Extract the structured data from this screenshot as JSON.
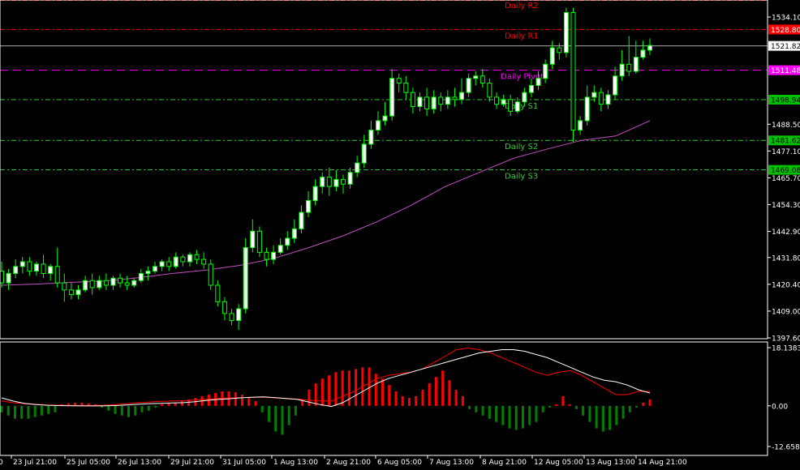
{
  "chart_data": [
    {
      "type": "candlestick",
      "price_axis_ticks": [
        "1534.10",
        "1521.82",
        "1511.48",
        "1498.94",
        "1488.50",
        "1477.10",
        "1465.70",
        "1454.30",
        "1442.90",
        "1431.80",
        "1420.40",
        "1409.00",
        "1397.60"
      ],
      "time_axis_ticks": [
        "23 Jul 21:00",
        "25 Jul 05:00",
        "26 Jul 13:00",
        "29 Jul 21:00",
        "31 Jul 05:00",
        "1 Aug 13:00",
        "2 Aug 21:00",
        "6 Aug 05:00",
        "7 Aug 13:00",
        "8 Aug 21:00",
        "12 Aug 05:00",
        "13 Aug 13:00",
        "14 Aug 21:00"
      ],
      "ylim": [
        1397.6,
        1534.1
      ],
      "current_price": "1521.82",
      "pivot_levels": [
        {
          "label": "Daily R2",
          "price_label": "",
          "price": 1542.0,
          "color": "#ff0000",
          "style": "dashdot"
        },
        {
          "label": "Daily R1",
          "price_label": "1528.80",
          "price": 1528.8,
          "color": "#ff0000",
          "style": "dashdot"
        },
        {
          "label": "Daily Pivot",
          "price_label": "1511.48",
          "price": 1511.48,
          "color": "#ff00ff",
          "style": "dashed"
        },
        {
          "label": "Daily S1",
          "price_label": "1498.94",
          "price": 1498.94,
          "color": "#32cd32",
          "style": "dashdot"
        },
        {
          "label": "Daily S2",
          "price_label": "1481.62",
          "price": 1481.62,
          "color": "#32cd32",
          "style": "dashdot"
        },
        {
          "label": "Daily S3",
          "price_label": "1469.08",
          "price": 1469.08,
          "color": "#32cd32",
          "style": "dashdot"
        }
      ],
      "colors": {
        "up_candle": "#ffffff",
        "down_candle": "#000000",
        "wick": "#00ff00",
        "moving_average": "#c050c0",
        "grid_line": "#ffffff"
      },
      "moving_average": [
        1420.0,
        1420.5,
        1421.2,
        1421.8,
        1423.2,
        1425.0,
        1426.5,
        1428.5,
        1431.5,
        1436.0,
        1441.0,
        1447.0,
        1454.0,
        1462.0,
        1468.0,
        1474.0,
        1478.0,
        1481.62,
        1483.5,
        1490.0
      ],
      "candles": [
        [
          1426,
          1421,
          1430,
          1419
        ],
        [
          1421,
          1425,
          1427,
          1418
        ],
        [
          1425,
          1428,
          1431,
          1423
        ],
        [
          1428,
          1430,
          1432,
          1425
        ],
        [
          1430,
          1426,
          1432,
          1424
        ],
        [
          1426,
          1429,
          1430,
          1424
        ],
        [
          1429,
          1425,
          1433,
          1423
        ],
        [
          1425,
          1428,
          1429,
          1422
        ],
        [
          1428,
          1421,
          1436,
          1419
        ],
        [
          1421,
          1418,
          1425,
          1413
        ],
        [
          1418,
          1416,
          1421,
          1414
        ],
        [
          1416,
          1418,
          1420,
          1414
        ],
        [
          1418,
          1422,
          1424,
          1417
        ],
        [
          1422,
          1419,
          1425,
          1416
        ],
        [
          1419,
          1422,
          1424,
          1418
        ],
        [
          1422,
          1420,
          1425,
          1418
        ],
        [
          1420,
          1423,
          1424,
          1418
        ],
        [
          1423,
          1421,
          1425,
          1419
        ],
        [
          1421,
          1420,
          1424,
          1418
        ],
        [
          1420,
          1422,
          1423,
          1419
        ],
        [
          1422,
          1425,
          1427,
          1421
        ],
        [
          1425,
          1426,
          1428,
          1422
        ],
        [
          1426,
          1428,
          1430,
          1425
        ],
        [
          1428,
          1430,
          1431,
          1426
        ],
        [
          1430,
          1428,
          1432,
          1426
        ],
        [
          1428,
          1432,
          1434,
          1427
        ],
        [
          1432,
          1430,
          1433,
          1428
        ],
        [
          1430,
          1433,
          1434,
          1428
        ],
        [
          1433,
          1431,
          1435,
          1429
        ],
        [
          1431,
          1429,
          1434,
          1427
        ],
        [
          1429,
          1420,
          1431,
          1418
        ],
        [
          1420,
          1413,
          1422,
          1411
        ],
        [
          1413,
          1408,
          1415,
          1405
        ],
        [
          1408,
          1405,
          1410,
          1403
        ],
        [
          1405,
          1410,
          1412,
          1401
        ],
        [
          1410,
          1436,
          1440,
          1408
        ],
        [
          1436,
          1443,
          1448,
          1434
        ],
        [
          1443,
          1434,
          1445,
          1432
        ],
        [
          1434,
          1431,
          1436,
          1428
        ],
        [
          1431,
          1434,
          1437,
          1429
        ],
        [
          1434,
          1437,
          1440,
          1433
        ],
        [
          1437,
          1440,
          1443,
          1435
        ],
        [
          1440,
          1444,
          1448,
          1438
        ],
        [
          1444,
          1451,
          1454,
          1442
        ],
        [
          1451,
          1456,
          1460,
          1449
        ],
        [
          1456,
          1462,
          1465,
          1454
        ],
        [
          1462,
          1466,
          1468,
          1459
        ],
        [
          1466,
          1462,
          1470,
          1458
        ],
        [
          1462,
          1465,
          1469,
          1460
        ],
        [
          1465,
          1463,
          1467,
          1459
        ],
        [
          1463,
          1468,
          1470,
          1461
        ],
        [
          1468,
          1472,
          1475,
          1466
        ],
        [
          1472,
          1480,
          1484,
          1470
        ],
        [
          1480,
          1486,
          1490,
          1478
        ],
        [
          1486,
          1490,
          1494,
          1484
        ],
        [
          1490,
          1492,
          1498,
          1488
        ],
        [
          1492,
          1508,
          1512,
          1490
        ],
        [
          1508,
          1506,
          1510,
          1502
        ],
        [
          1506,
          1502,
          1509,
          1499
        ],
        [
          1502,
          1496,
          1504,
          1493
        ],
        [
          1496,
          1500,
          1502,
          1494
        ],
        [
          1500,
          1495,
          1504,
          1492
        ],
        [
          1495,
          1500,
          1503,
          1493
        ],
        [
          1500,
          1497,
          1502,
          1494
        ],
        [
          1497,
          1500,
          1503,
          1495
        ],
        [
          1500,
          1499,
          1504,
          1496
        ],
        [
          1499,
          1502,
          1508,
          1497
        ],
        [
          1502,
          1508,
          1510,
          1500
        ],
        [
          1508,
          1509,
          1511,
          1505
        ],
        [
          1509,
          1506,
          1512,
          1504
        ],
        [
          1506,
          1500,
          1508,
          1498
        ],
        [
          1500,
          1497,
          1502,
          1495
        ],
        [
          1497,
          1499,
          1501,
          1496
        ],
        [
          1499,
          1494,
          1501,
          1492
        ],
        [
          1494,
          1498,
          1500,
          1493
        ],
        [
          1498,
          1502,
          1504,
          1496
        ],
        [
          1502,
          1505,
          1508,
          1500
        ],
        [
          1505,
          1508,
          1511,
          1503
        ],
        [
          1508,
          1514,
          1516,
          1506
        ],
        [
          1514,
          1521,
          1524,
          1512
        ],
        [
          1521,
          1519,
          1523,
          1516
        ],
        [
          1519,
          1536,
          1538,
          1517
        ],
        [
          1536,
          1486,
          1538,
          1481
        ],
        [
          1486,
          1490,
          1492,
          1484
        ],
        [
          1490,
          1500,
          1505,
          1488
        ],
        [
          1500,
          1502,
          1505,
          1498
        ],
        [
          1502,
          1497,
          1504,
          1494
        ],
        [
          1497,
          1501,
          1503,
          1495
        ],
        [
          1501,
          1509,
          1513,
          1499
        ],
        [
          1509,
          1514,
          1520,
          1507
        ],
        [
          1514,
          1511,
          1526,
          1509
        ],
        [
          1511,
          1517,
          1524,
          1510
        ],
        [
          1517,
          1520,
          1524,
          1516
        ],
        [
          1520,
          1522,
          1525,
          1518
        ]
      ]
    },
    {
      "type": "histogram-oscillator",
      "yaxis_ticks": [
        "18.1383",
        "0.00",
        "-12.6583"
      ],
      "ylim": [
        -12.6583,
        18.1383
      ],
      "colors": {
        "positive": "#ff0000",
        "negative": "#008000",
        "signal_fast": "#ffffff",
        "signal_slow": "#ff0000"
      },
      "histogram": [
        -2,
        -3,
        -4,
        -4,
        -4,
        -3.5,
        -3,
        -2.5,
        -2,
        0.5,
        0.8,
        1,
        1,
        0.8,
        0.5,
        -0.5,
        -1.5,
        -2.5,
        -3,
        -3.5,
        -3,
        -2,
        -1.5,
        -0.5,
        0.5,
        1,
        1,
        1.5,
        2,
        2.5,
        3,
        3.5,
        4,
        4.5,
        4.5,
        4.3,
        3.5,
        2.5,
        1.5,
        -2,
        -5,
        -8,
        -9,
        -6,
        -3,
        2,
        5,
        7,
        8.5,
        9.5,
        10.5,
        11,
        11,
        11.5,
        12,
        12,
        10,
        8.5,
        6.5,
        4.5,
        3,
        2.5,
        3,
        5,
        7,
        9,
        11,
        8,
        5,
        3,
        -1,
        -2,
        -3,
        -4,
        -5,
        -6,
        -7,
        -7.5,
        -7,
        -6,
        -5,
        -2,
        -0.5,
        0.5,
        3,
        0.5,
        -1,
        -3,
        -5,
        -7,
        -8,
        -7.5,
        -6,
        -4,
        -2,
        -0.5,
        1,
        2
      ],
      "line_fast": [
        2.5,
        1.5,
        0.8,
        0.4,
        0.2,
        0.1,
        0.05,
        0,
        0,
        0,
        0.1,
        0.3,
        0.5,
        0.7,
        0.8,
        0.9,
        1,
        1.3,
        1.7,
        2,
        2.2,
        2.5,
        2.7,
        2.8,
        2.6,
        2.3,
        2,
        1.2,
        0.4,
        -0.2,
        1,
        3,
        5,
        7,
        8.5,
        9.5,
        10.5,
        11.5,
        12.5,
        13.5,
        14.5,
        15.5,
        16.5,
        17,
        17.5,
        17.5,
        17,
        16,
        15,
        13.5,
        12,
        10.5,
        9,
        8,
        7.5,
        6.5,
        5,
        4
      ],
      "line_slow": [
        1.5,
        1,
        0.7,
        0.5,
        0.3,
        0.2,
        0.15,
        0.1,
        0.1,
        0.2,
        0.4,
        0.7,
        1,
        1.2,
        1.4,
        1.5,
        1.6,
        1.8,
        2,
        2.3,
        2.5,
        2.6,
        2.7,
        2.7,
        2.5,
        2.3,
        2.1,
        1.8,
        1.5,
        1.5,
        3,
        4.5,
        6.5,
        8.5,
        9.5,
        10,
        10.5,
        11.5,
        13.5,
        15.5,
        17.5,
        18,
        17.5,
        16.5,
        15,
        13.5,
        12,
        10.5,
        9.5,
        10.5,
        11,
        9.5,
        7.5,
        5.5,
        3.5,
        3.5,
        4.5,
        4.5
      ]
    }
  ]
}
